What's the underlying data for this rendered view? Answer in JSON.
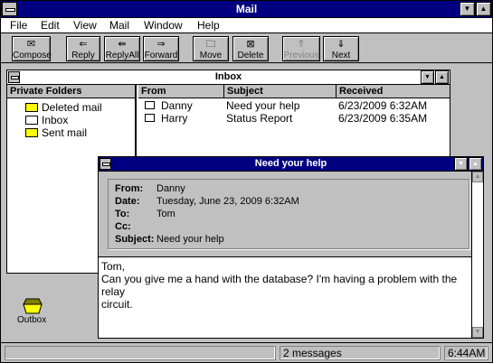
{
  "app": {
    "title": "Mail"
  },
  "menu": [
    "File",
    "Edit",
    "View",
    "Mail",
    "Window",
    "Help"
  ],
  "toolbar": {
    "compose": "Compose",
    "reply": "Reply",
    "reply_all": "ReplyAll",
    "forward": "Forward",
    "move": "Move",
    "delete": "Delete",
    "previous": "Previous",
    "next": "Next"
  },
  "inbox": {
    "title": "Inbox",
    "folders_header": "Private Folders",
    "folders": [
      "Deleted mail",
      "Inbox",
      "Sent mail"
    ],
    "columns": {
      "from": "From",
      "subject": "Subject",
      "received": "Received"
    },
    "messages": [
      {
        "from": "Danny",
        "subject": "Need your help",
        "received": "6/23/2009 6:32AM"
      },
      {
        "from": "Harry",
        "subject": "Status Report",
        "received": "6/23/2009 6:35AM"
      }
    ]
  },
  "outbox": {
    "label": "Outbox"
  },
  "message": {
    "title": "Need your help",
    "labels": {
      "from": "From:",
      "date": "Date:",
      "to": "To:",
      "cc": "Cc:",
      "subject": "Subject:"
    },
    "from": "Danny",
    "date": "Tuesday, June 23, 2009 6:32AM",
    "to": "Tom",
    "cc": "",
    "subject": "Need your help",
    "body_line1": "Tom,",
    "body_line2": "Can you give me a hand with the database? I'm having a problem with the relay",
    "body_line3": "circuit."
  },
  "status": {
    "count": "2 messages",
    "time": "6:44AM"
  }
}
